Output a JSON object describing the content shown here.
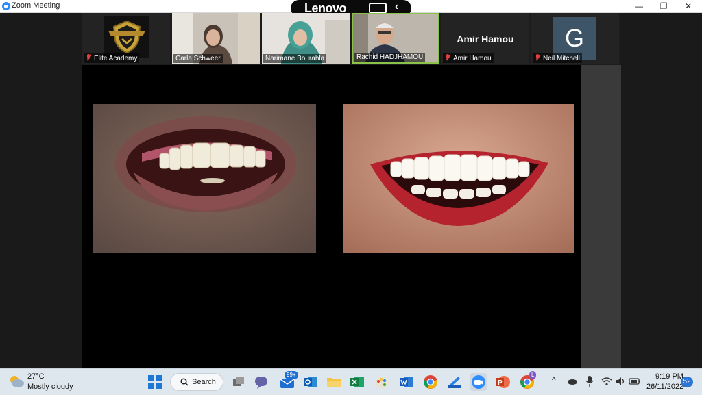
{
  "window": {
    "title": "Zoom Meeting",
    "controls": {
      "minimize": "—",
      "restore": "❐",
      "close": "✕"
    }
  },
  "overlay": {
    "brand": "Lenovo",
    "chevron": "‹"
  },
  "participants": [
    {
      "name": "Elite Academy",
      "muted": true,
      "type": "logo"
    },
    {
      "name": "Carla Schweer",
      "muted": false,
      "type": "video"
    },
    {
      "name": "Narimane Bourahla",
      "muted": false,
      "type": "video"
    },
    {
      "name": "Rachid HADJHAMOU",
      "muted": false,
      "type": "video",
      "active_speaker": true
    },
    {
      "name": "Amir Hamou",
      "muted": true,
      "type": "name",
      "display_name": "Amir Hamou"
    },
    {
      "name": "Neil Mitchell",
      "muted": true,
      "type": "avatar",
      "initial": "G"
    }
  ],
  "taskbar": {
    "weather": {
      "temp": "27°C",
      "condition": "Mostly cloudy"
    },
    "search_label": "Search",
    "mail_badge": "99+",
    "chrome_badge": "L",
    "clock": {
      "time": "9:19 PM",
      "date": "26/11/2022"
    },
    "notifications": "52",
    "tray_chevron": "^"
  },
  "colors": {
    "zoom_blue": "#2d8cff",
    "muted_red": "#e0403b",
    "active_speaker_border": "#8bc34a",
    "avatar_bg": "#3d5566"
  }
}
